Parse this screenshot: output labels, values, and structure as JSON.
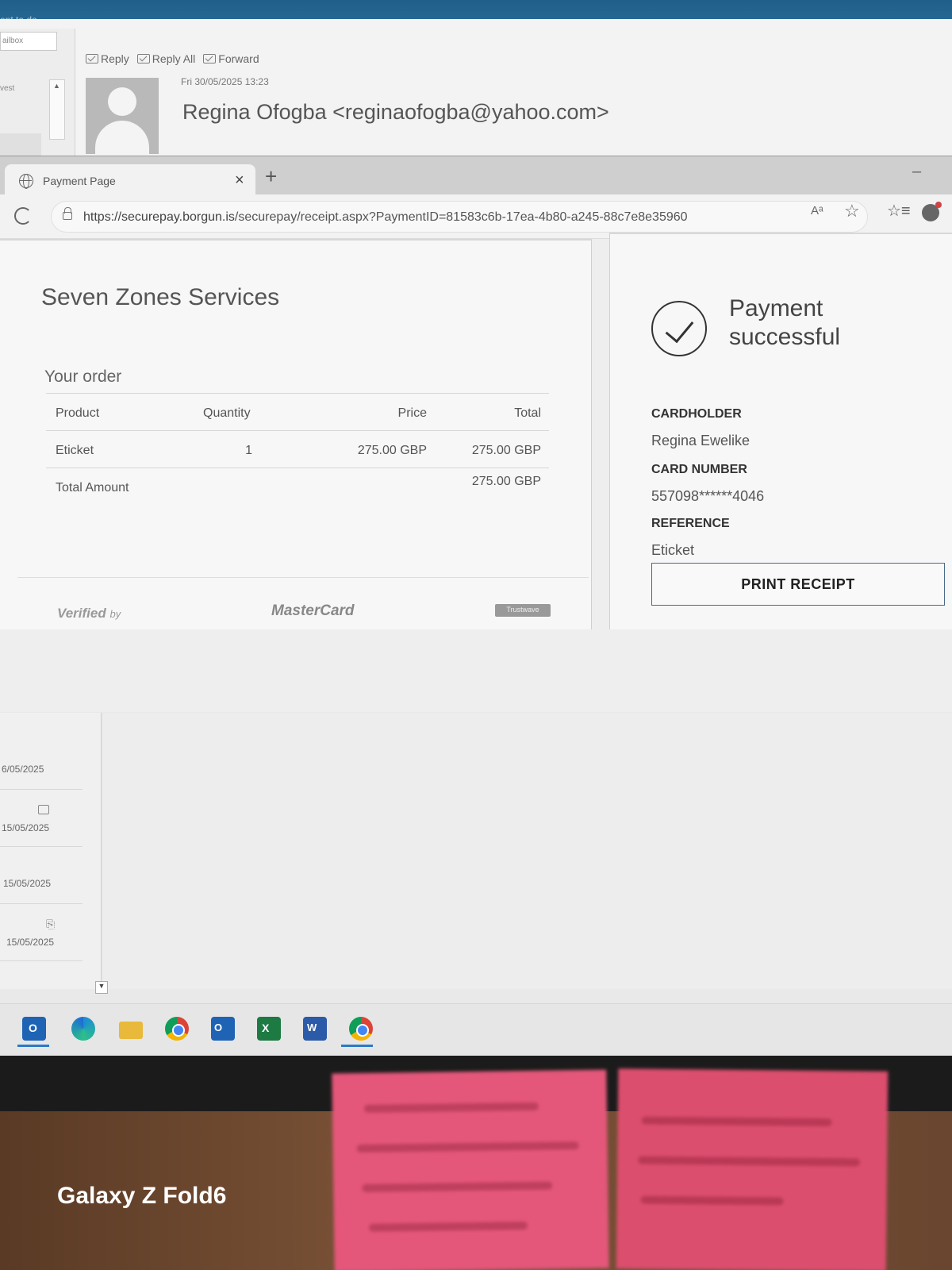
{
  "outlook": {
    "window_title": "ent to do...",
    "mailbox_select": "ailbox",
    "sort_label": "vest",
    "actions": {
      "reply": "Reply",
      "reply_all": "Reply All",
      "forward": "Forward"
    },
    "sent_date": "Fri 30/05/2025 13:23",
    "sender": "Regina Ofogba <reginaofogba@yahoo.com>",
    "list_dates": [
      "6/05/2025",
      "15/05/2025",
      "15/05/2025",
      "15/05/2025"
    ]
  },
  "browser": {
    "tab_title": "Payment Page",
    "url_host": "https://securepay.borgun.is",
    "url_path": "/securepay/receipt.aspx?PaymentID=81583c6b-17ea-4b80-a245-88c7e8e35960",
    "read_aloud": "Aᵃ"
  },
  "order": {
    "merchant": "Seven Zones Services",
    "heading": "Your order",
    "columns": [
      "Product",
      "Quantity",
      "Price",
      "Total"
    ],
    "items": [
      {
        "product": "Eticket",
        "quantity": "1",
        "price": "275.00 GBP",
        "total": "275.00 GBP"
      }
    ],
    "total_label": "Total Amount",
    "total_value": "275.00 GBP",
    "footer": {
      "verified": "Verified",
      "verified_by": "by",
      "mastercard": "MasterCard",
      "trustwave": "Trustwave"
    }
  },
  "status": {
    "title": "Payment successful",
    "cardholder_label": "CARDHOLDER",
    "cardholder": "Regina Ewelike",
    "card_number_label": "CARD NUMBER",
    "card_number": "557098******4046",
    "reference_label": "REFERENCE",
    "reference": "Eticket",
    "print_button": "PRINT RECEIPT"
  },
  "device_watermark": "Galaxy Z Fold6"
}
